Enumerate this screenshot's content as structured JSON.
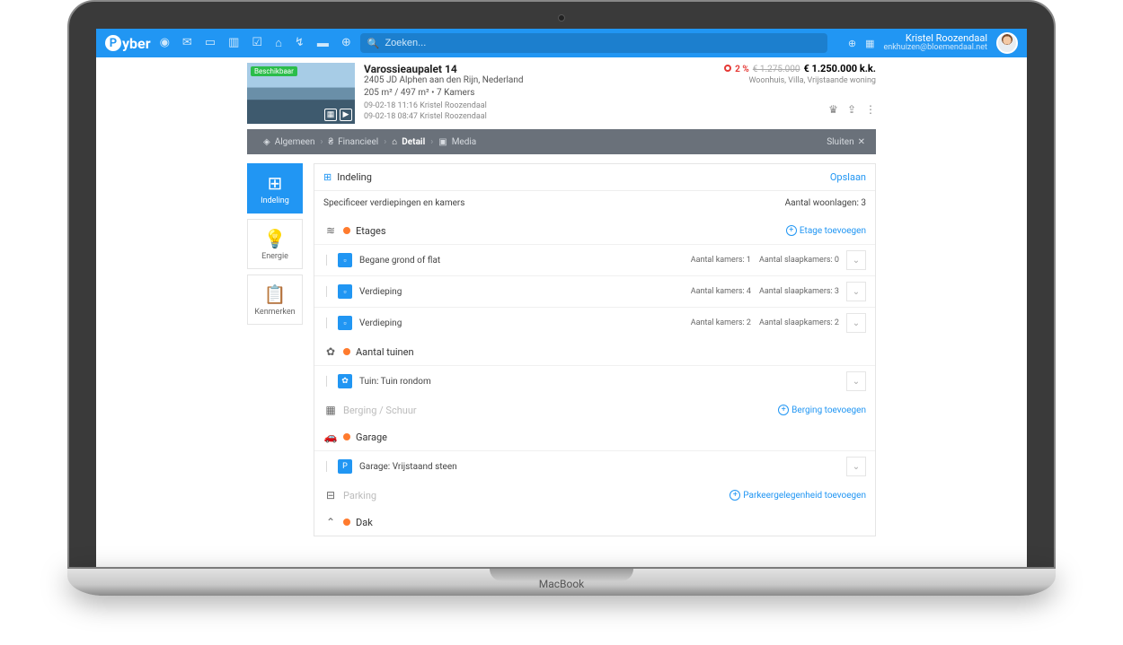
{
  "brand": "Pyber",
  "search": {
    "placeholder": "Zoeken..."
  },
  "user": {
    "name": "Kristel Roozendaal",
    "sub": "enkhuizen@bloemendaal.net"
  },
  "base_label": "MacBook",
  "property": {
    "badge": "Beschikbaar",
    "title": "Varossieaupalet 14",
    "address": "2405 JD Alphen aan den Rijn, Nederland",
    "meta": "205 m² / 497 m² • 7 Kamers",
    "log1": "09-02-18 11:16 Kristel Roozendaal",
    "log2": "09-02-18 08:47 Kristel Roozendaal",
    "pct": "2 %",
    "old_price": "€ 1.275.000",
    "new_price": "€ 1.250.000 k.k.",
    "type": "Woonhuis, Villa, Vrijstaande woning"
  },
  "crumbs": {
    "algemeen": "Algemeen",
    "financieel": "Financieel",
    "detail": "Detail",
    "media": "Media",
    "close": "Sluiten"
  },
  "sidetabs": {
    "indeling": "Indeling",
    "energie": "Energie",
    "kenmerken": "Kenmerken"
  },
  "panel": {
    "title": "Indeling",
    "save": "Opslaan",
    "intro": "Specificeer verdiepingen en kamers",
    "woonlagen": "Aantal woonlagen: 3"
  },
  "sections": {
    "etages": {
      "title": "Etages",
      "add": "Etage toevoegen",
      "rows": [
        {
          "title": "Begane grond of flat",
          "kamers": "Aantal kamers: 1",
          "slaap": "Aantal slaapkamers: 0"
        },
        {
          "title": "Verdieping",
          "kamers": "Aantal kamers: 4",
          "slaap": "Aantal slaapkamers: 3"
        },
        {
          "title": "Verdieping",
          "kamers": "Aantal kamers: 2",
          "slaap": "Aantal slaapkamers: 2"
        }
      ]
    },
    "tuinen": {
      "title": "Aantal tuinen",
      "row": "Tuin: Tuin rondom"
    },
    "berging": {
      "title": "Berging / Schuur",
      "add": "Berging toevoegen"
    },
    "garage": {
      "title": "Garage",
      "row": "Garage: Vrijstaand steen"
    },
    "parking": {
      "title": "Parking",
      "add": "Parkeergelegenheid toevoegen"
    },
    "dak": {
      "title": "Dak"
    }
  }
}
